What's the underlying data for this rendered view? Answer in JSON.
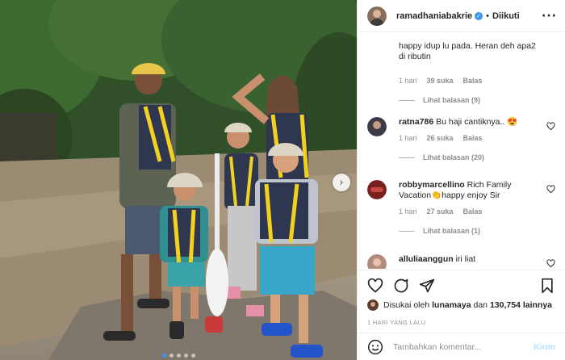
{
  "post": {
    "username": "ramadhaniabakrie",
    "separator": "•",
    "follow_state": "Diikuti",
    "more_icon": "more-horizontal-icon",
    "verified_icon": "verified-badge-icon"
  },
  "carousel": {
    "slide_count": 5,
    "active_slide": 1,
    "next_icon": "chevron-right-icon"
  },
  "comments": [
    {
      "username": "",
      "text": "happy idup lu pada. Heran deh apa2 di ributin",
      "time": "1 hari",
      "likes": "39 suka",
      "reply_label": "Balas",
      "view_replies": "Lihat balasan (9)"
    },
    {
      "username": "ratna786",
      "text": "Bu haji cantiknya.. 😍",
      "time": "1 hari",
      "likes": "26 suka",
      "reply_label": "Balas",
      "view_replies": "Lihat balasan (20)"
    },
    {
      "username": "robbymarcellino",
      "text": "Rich Family Vacation👏happy enjoy Sir",
      "time": "1 hari",
      "likes": "27 suka",
      "reply_label": "Balas",
      "view_replies": "Lihat balasan (1)"
    },
    {
      "username": "alluliaanggun",
      "text": "iri liat"
    }
  ],
  "actions": {
    "like_icon": "heart-icon",
    "comment_icon": "comment-icon",
    "share_icon": "share-icon",
    "save_icon": "bookmark-icon"
  },
  "likes": {
    "prefix": "Disukai oleh",
    "user": "lunamaya",
    "connector": "dan",
    "count": "130,754 lainnya"
  },
  "date_label": "1 HARI YANG LALU",
  "add_comment": {
    "emoji_icon": "emoji-icon",
    "placeholder": "Tambahkan komentar...",
    "post_label": "Kirim"
  },
  "colors": {
    "link_blue": "#3897f0",
    "post_disabled": "#b2dffc",
    "secondary_text": "#8e8e8e",
    "heart_red": "#ed4956"
  }
}
